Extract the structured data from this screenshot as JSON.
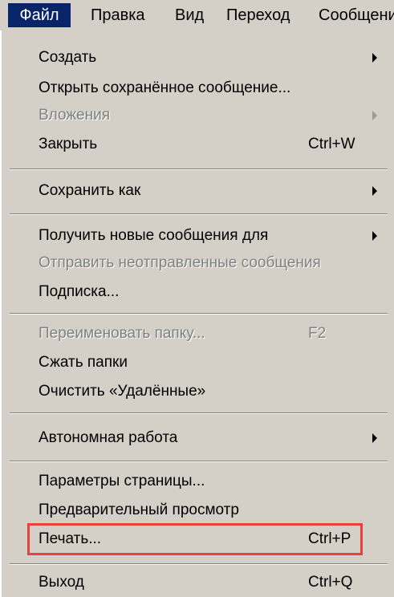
{
  "menubar": {
    "items": [
      {
        "label": "Файл"
      },
      {
        "label": "Правка"
      },
      {
        "label": "Вид"
      },
      {
        "label": "Переход"
      },
      {
        "label": "Сообщени"
      }
    ]
  },
  "menu": {
    "items": [
      {
        "label": "Создать",
        "shortcut": "",
        "submenu": true,
        "enabled": true
      },
      {
        "label": "Открыть сохранённое сообщение...",
        "shortcut": "",
        "submenu": false,
        "enabled": true
      },
      {
        "label": "Вложения",
        "shortcut": "",
        "submenu": true,
        "enabled": false
      },
      {
        "label": "Закрыть",
        "shortcut": "Ctrl+W",
        "submenu": false,
        "enabled": true
      },
      {
        "label": "Сохранить как",
        "shortcut": "",
        "submenu": true,
        "enabled": true
      },
      {
        "label": "Получить новые сообщения для",
        "shortcut": "",
        "submenu": true,
        "enabled": true
      },
      {
        "label": "Отправить неотправленные сообщения",
        "shortcut": "",
        "submenu": false,
        "enabled": false
      },
      {
        "label": "Подписка...",
        "shortcut": "",
        "submenu": false,
        "enabled": true
      },
      {
        "label": "Переименовать папку...",
        "shortcut": "F2",
        "submenu": false,
        "enabled": false
      },
      {
        "label": "Сжать папки",
        "shortcut": "",
        "submenu": false,
        "enabled": true
      },
      {
        "label": "Очистить «Удалённые»",
        "shortcut": "",
        "submenu": false,
        "enabled": true
      },
      {
        "label": "Автономная работа",
        "shortcut": "",
        "submenu": true,
        "enabled": true
      },
      {
        "label": "Параметры страницы...",
        "shortcut": "",
        "submenu": false,
        "enabled": true
      },
      {
        "label": "Предварительный просмотр",
        "shortcut": "",
        "submenu": false,
        "enabled": true
      },
      {
        "label": "Печать...",
        "shortcut": "Ctrl+P",
        "submenu": false,
        "enabled": true,
        "highlighted": true
      },
      {
        "label": "Выход",
        "shortcut": "Ctrl+Q",
        "submenu": false,
        "enabled": true
      }
    ]
  },
  "colors": {
    "menu_bg": "#d4d0c8",
    "active_bg": "#0a246a",
    "disabled_text": "#808080",
    "highlight_border": "#e8413c"
  }
}
